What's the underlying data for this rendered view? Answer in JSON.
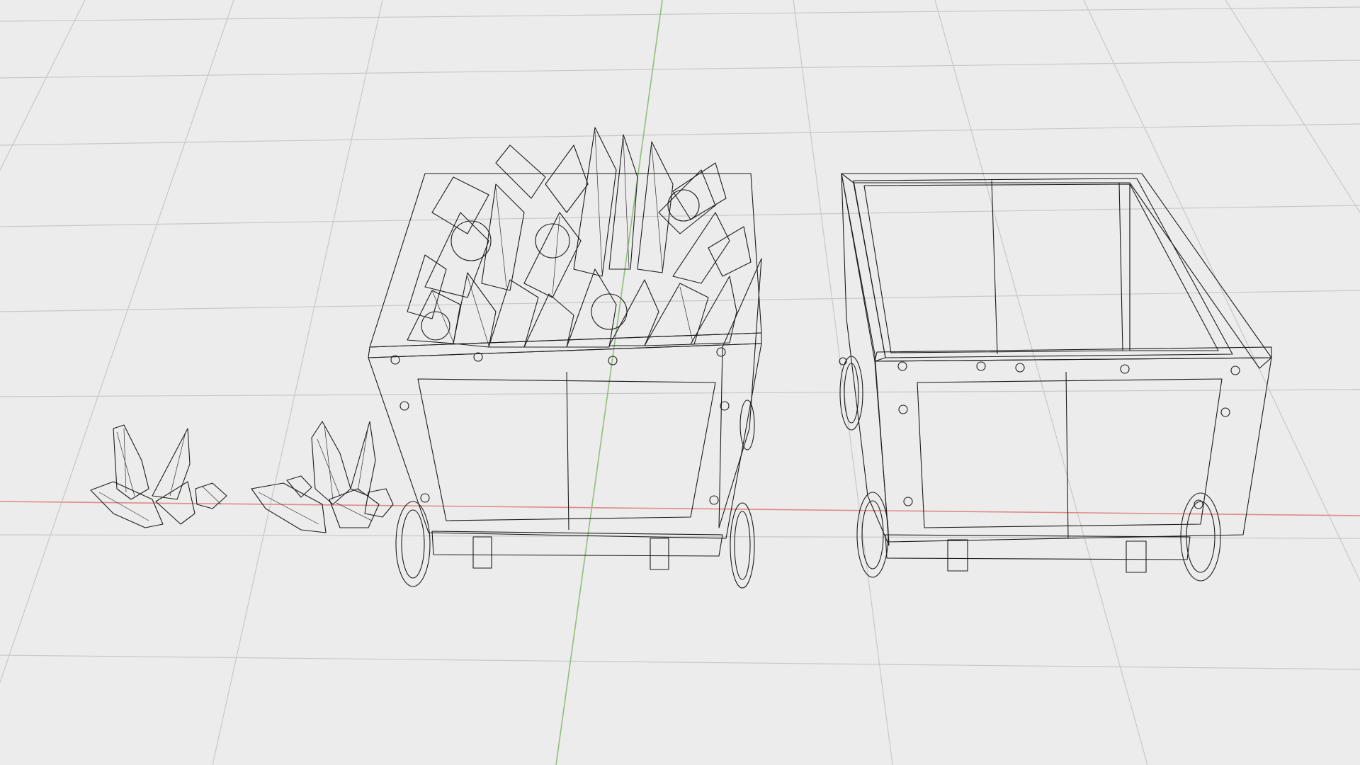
{
  "viewport": {
    "background": "#ececec",
    "grid_color": "#c8c8c8",
    "axis_x_color": "#e08a8a",
    "axis_y_color": "#8fc07a",
    "mesh_fill": "#a3a3a3",
    "mesh_fill_light": "#b8b8b8",
    "mesh_fill_dark": "#8c8c8c",
    "wire_color": "#1c1c1c"
  },
  "objects": {
    "crystal_cluster_small": {
      "icon": "crystal-cluster-icon"
    },
    "crystal_cluster_medium": {
      "icon": "crystal-cluster-icon"
    },
    "mine_cart_loaded": {
      "icon": "mine-cart-icon"
    },
    "mine_cart_empty": {
      "icon": "mine-cart-icon"
    }
  }
}
